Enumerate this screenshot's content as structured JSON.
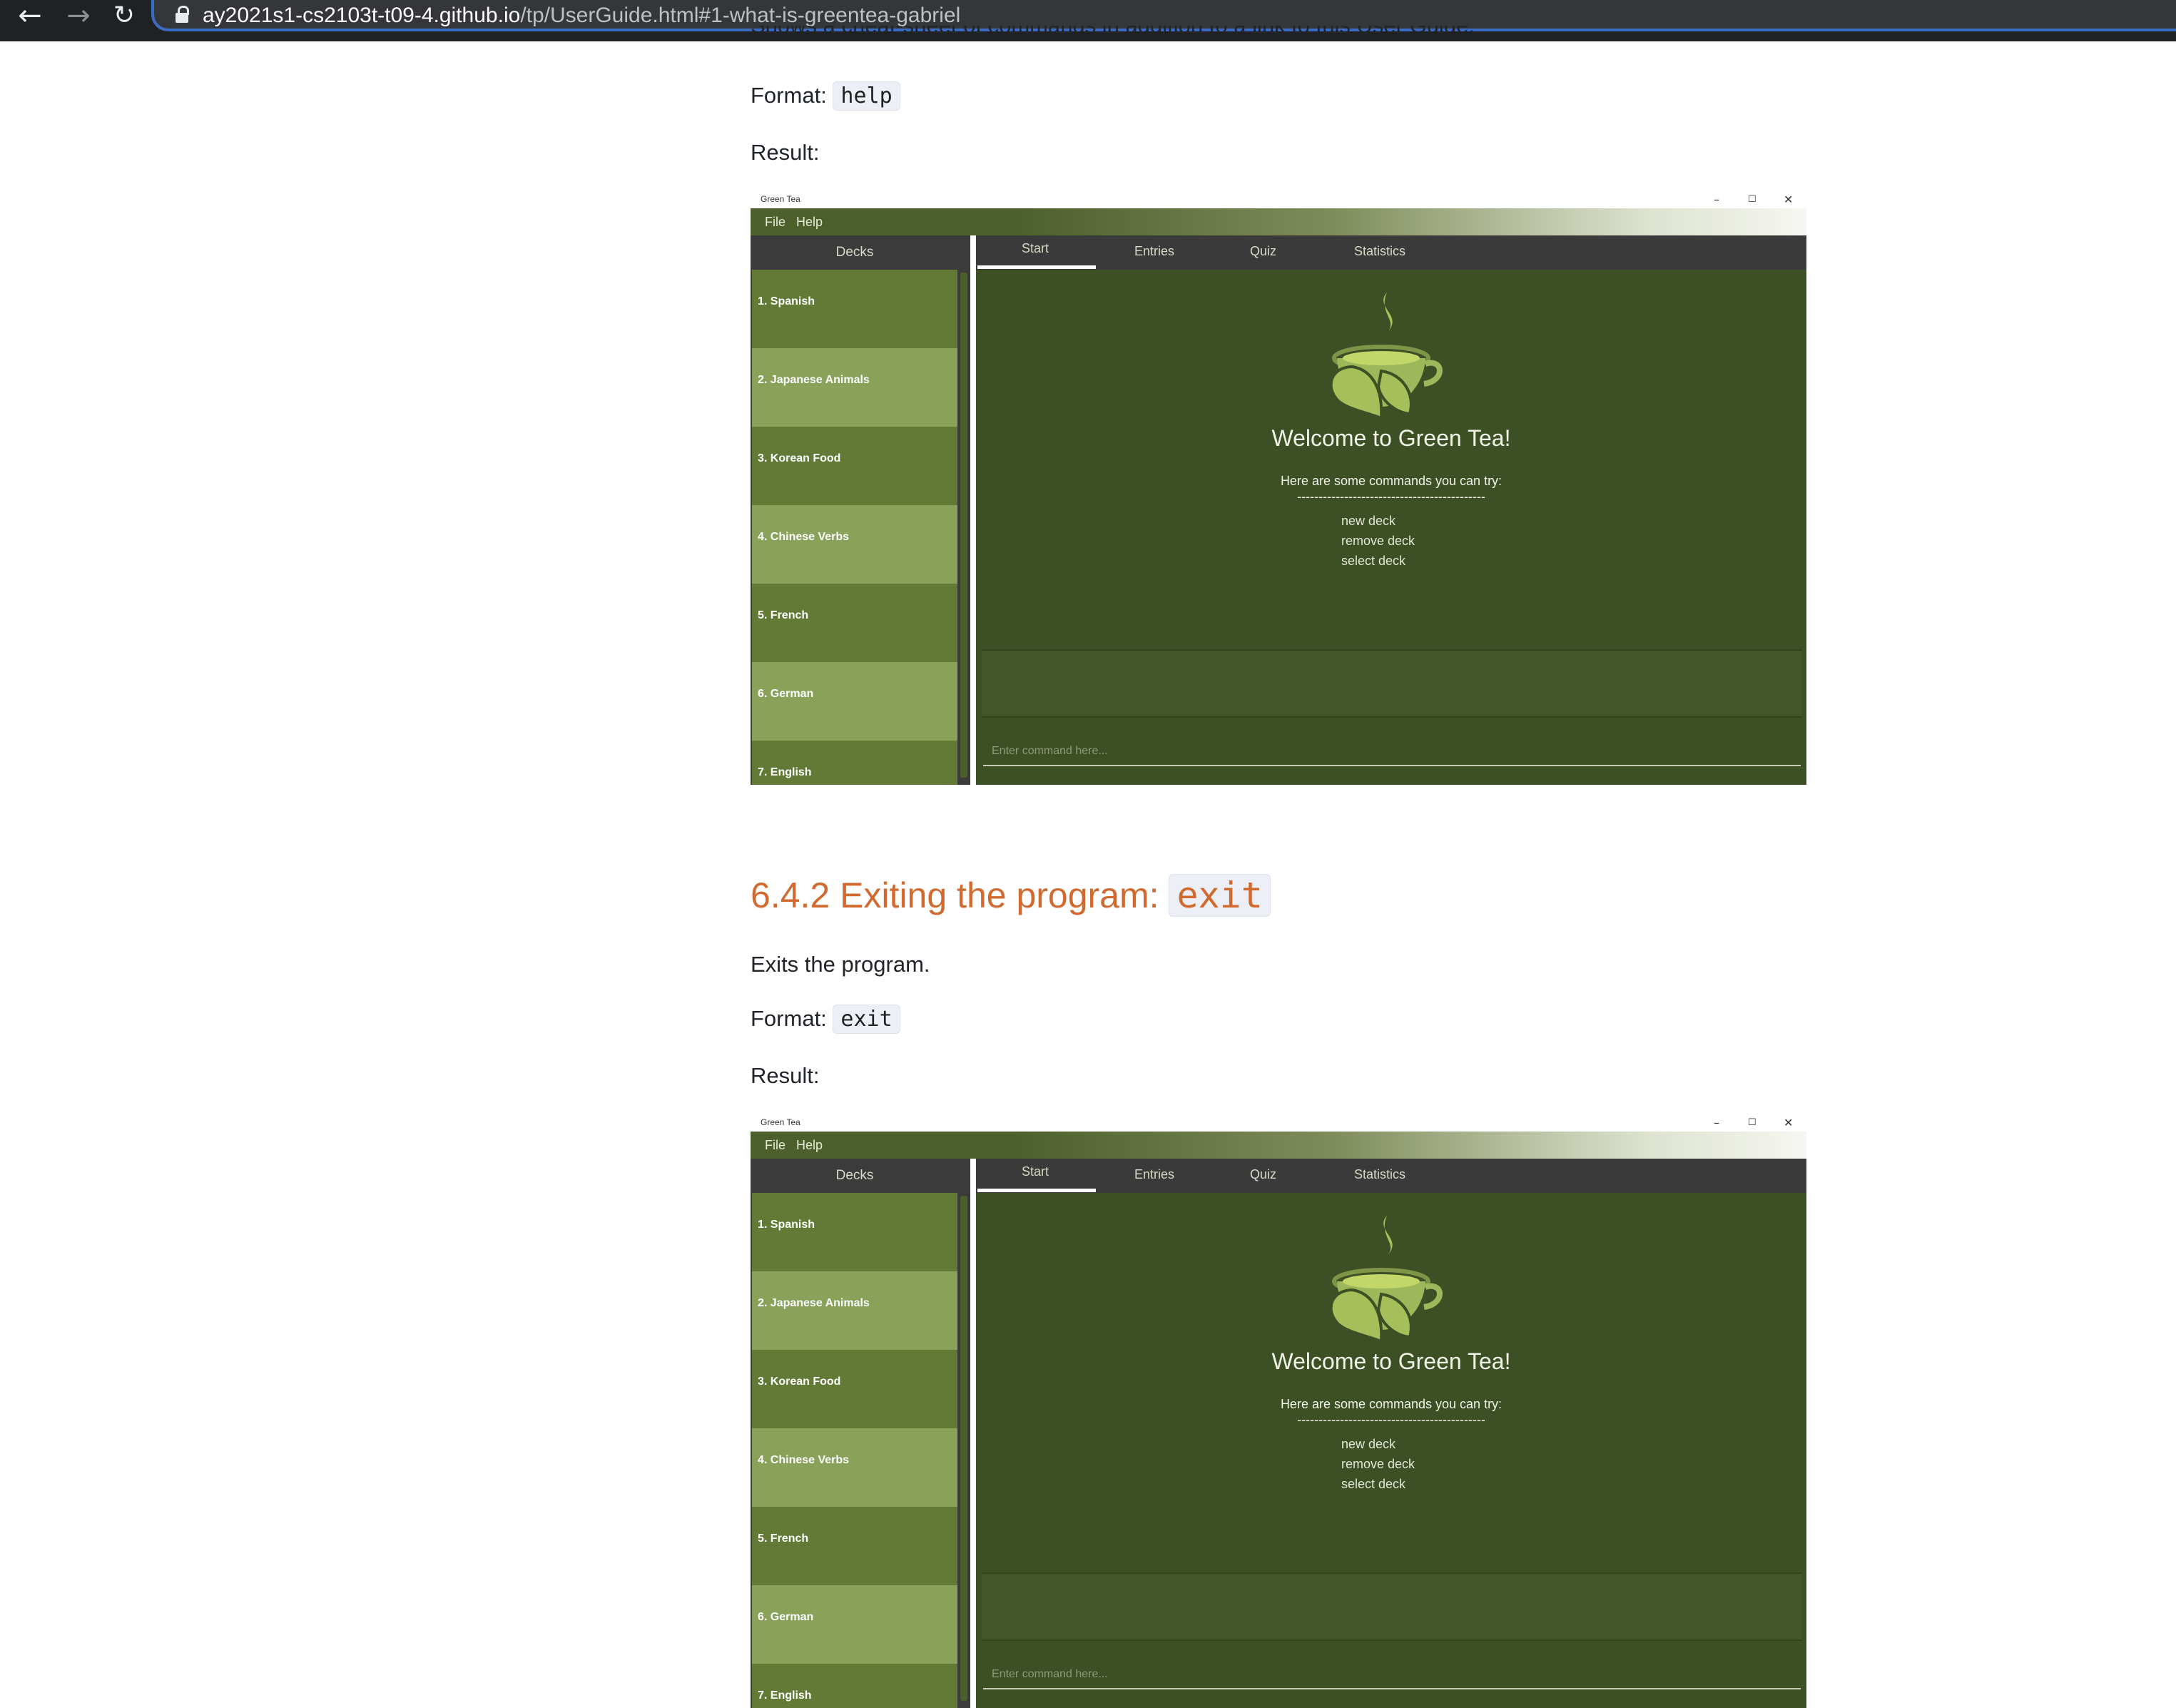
{
  "browser": {
    "url_host": "ay2021s1-cs2103t-t09-4.github.io",
    "url_path": "/tp/UserGuide.html#1-what-is-greentea-gabriel",
    "back_icon": "arrow-left-icon",
    "forward_icon": "arrow-right-icon",
    "reload_icon": "reload-icon",
    "lock_icon": "lock-icon"
  },
  "help_section": {
    "partial_text": "Shows a cheat-sheet of commands in addition to a link to this User Guide.",
    "format_label": "Format:",
    "format_code": "help",
    "result_label": "Result:"
  },
  "exit_section": {
    "heading_text": "6.4.2 Exiting the program:",
    "heading_code": "exit",
    "description": "Exits the program.",
    "format_label": "Format:",
    "format_code": "exit",
    "result_label": "Result:"
  },
  "app": {
    "window_title": "Green Tea",
    "window_controls": [
      "–",
      "☐",
      "✕"
    ],
    "menu": [
      "File",
      "Help"
    ],
    "sidebar_title": "Decks",
    "decks": [
      "1.  Spanish",
      "2.  Japanese Animals",
      "3.  Korean Food",
      "4.  Chinese Verbs",
      "5.  French",
      "6.  German",
      "7.  English"
    ],
    "tabs": [
      "Start",
      "Entries",
      "Quiz",
      "Statistics"
    ],
    "welcome_title": "Welcome to Green Tea!",
    "welcome_subtitle": "Here are some commands you can try:",
    "divider": "--------------------------------------------",
    "commands": [
      "new deck",
      "remove deck",
      "select deck"
    ],
    "command_placeholder": "Enter command here...",
    "colors": {
      "sidebar_dark": "#627a35",
      "sidebar_light": "#8aa15a",
      "main_bg": "#3d4f24",
      "heading": "#d26a30"
    }
  }
}
